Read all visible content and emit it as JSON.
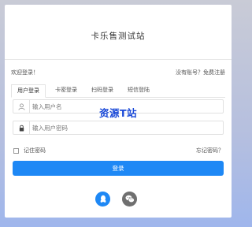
{
  "header": {
    "site_title": "卡乐售测试站"
  },
  "welcome_text": "欢迎登录！",
  "register": {
    "prompt": "没有账号？",
    "link_label": "免费注册"
  },
  "tabs": [
    {
      "label": "用户登录",
      "active": true
    },
    {
      "label": "卡密登录",
      "active": false
    },
    {
      "label": "扫码登录",
      "active": false
    },
    {
      "label": "短信登陆",
      "active": false
    }
  ],
  "form": {
    "username_placeholder": "输入用户名",
    "password_placeholder": "输入用户密码",
    "remember_label": "记住密码",
    "forgot_label": "忘记密码？",
    "submit_label": "登录"
  },
  "social": {
    "qq_icon": "qq-icon",
    "wechat_icon": "wechat-icon"
  },
  "watermark": "资源T站",
  "colors": {
    "primary": "#1e88f5",
    "secondary": "#6f6f6f",
    "watermark": "#1a49d8"
  }
}
